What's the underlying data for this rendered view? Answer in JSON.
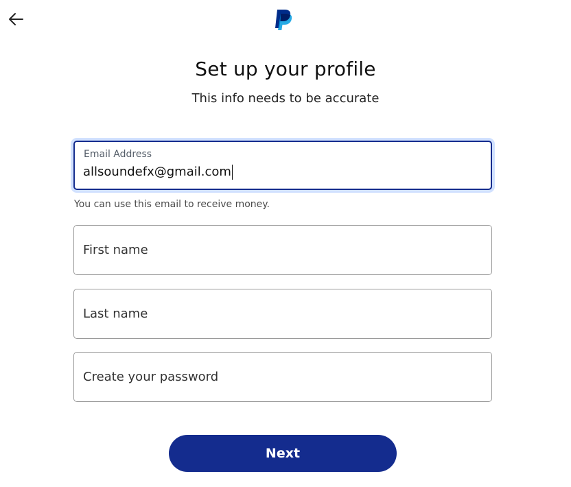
{
  "header": {
    "back_icon": "arrow-left-icon",
    "logo_icon": "paypal-logo-icon"
  },
  "title": "Set up your profile",
  "subtitle": "This info needs to be accurate",
  "form": {
    "email": {
      "label": "Email Address",
      "value": "allsoundefx@gmail.com",
      "helper": "You can use this email to receive money."
    },
    "first_name": {
      "placeholder": "First name"
    },
    "last_name": {
      "placeholder": "Last name"
    },
    "password": {
      "placeholder": "Create your password"
    }
  },
  "actions": {
    "next_label": "Next"
  },
  "colors": {
    "primary": "#142c8e",
    "focus_ring": "#d1e1ff",
    "logo_dark": "#002c8a",
    "logo_light": "#009be1"
  }
}
